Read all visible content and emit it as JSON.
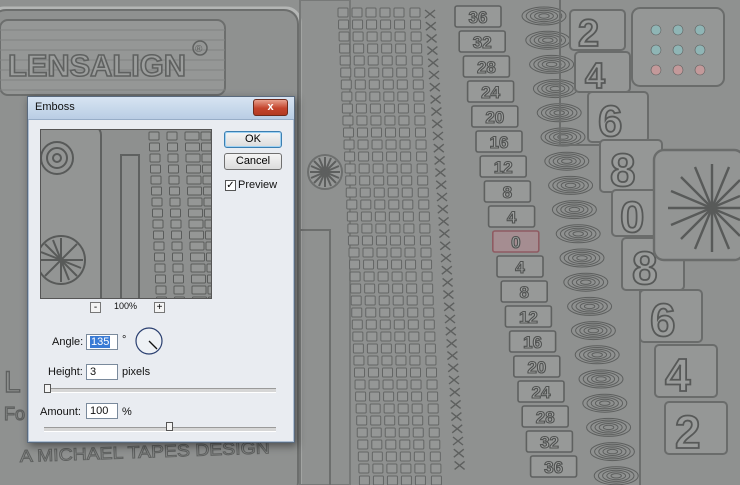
{
  "background": {
    "logo_text": "LENSALIGN",
    "logo_mark": "®",
    "side_fragment_1": "L",
    "side_fragment_2": "Fo",
    "credit_text": "A MICHAEL TAPES DESIGN",
    "ruler_numbers": [
      "36",
      "32",
      "28",
      "24",
      "20",
      "16",
      "12",
      "8",
      "4",
      "0",
      "4",
      "8",
      "12",
      "16",
      "20",
      "24",
      "28",
      "32",
      "36"
    ],
    "big_numbers_top": [
      "2",
      "4",
      "6",
      "8"
    ],
    "big_zero": "0",
    "big_numbers_bottom": [
      "8",
      "6",
      "4",
      "2"
    ]
  },
  "dialog": {
    "title": "Emboss",
    "close_label": "x",
    "ok_label": "OK",
    "cancel_label": "Cancel",
    "preview_label": "Preview",
    "preview_checked": true,
    "zoom_minus": "-",
    "zoom_level": "100%",
    "zoom_plus": "+",
    "angle_label": "Angle:",
    "angle_value": "135",
    "angle_unit": "°",
    "height_label": "Height:",
    "height_value": "3",
    "height_unit": "pixels",
    "amount_label": "Amount:",
    "amount_value": "100",
    "amount_unit": "%",
    "height_fraction": 0.0,
    "amount_fraction": 0.54
  },
  "colors": {
    "background": "#8f9190",
    "dialog": "#e9ecf1",
    "close_button": "#c4442d",
    "selection": "#3a7bd5"
  }
}
